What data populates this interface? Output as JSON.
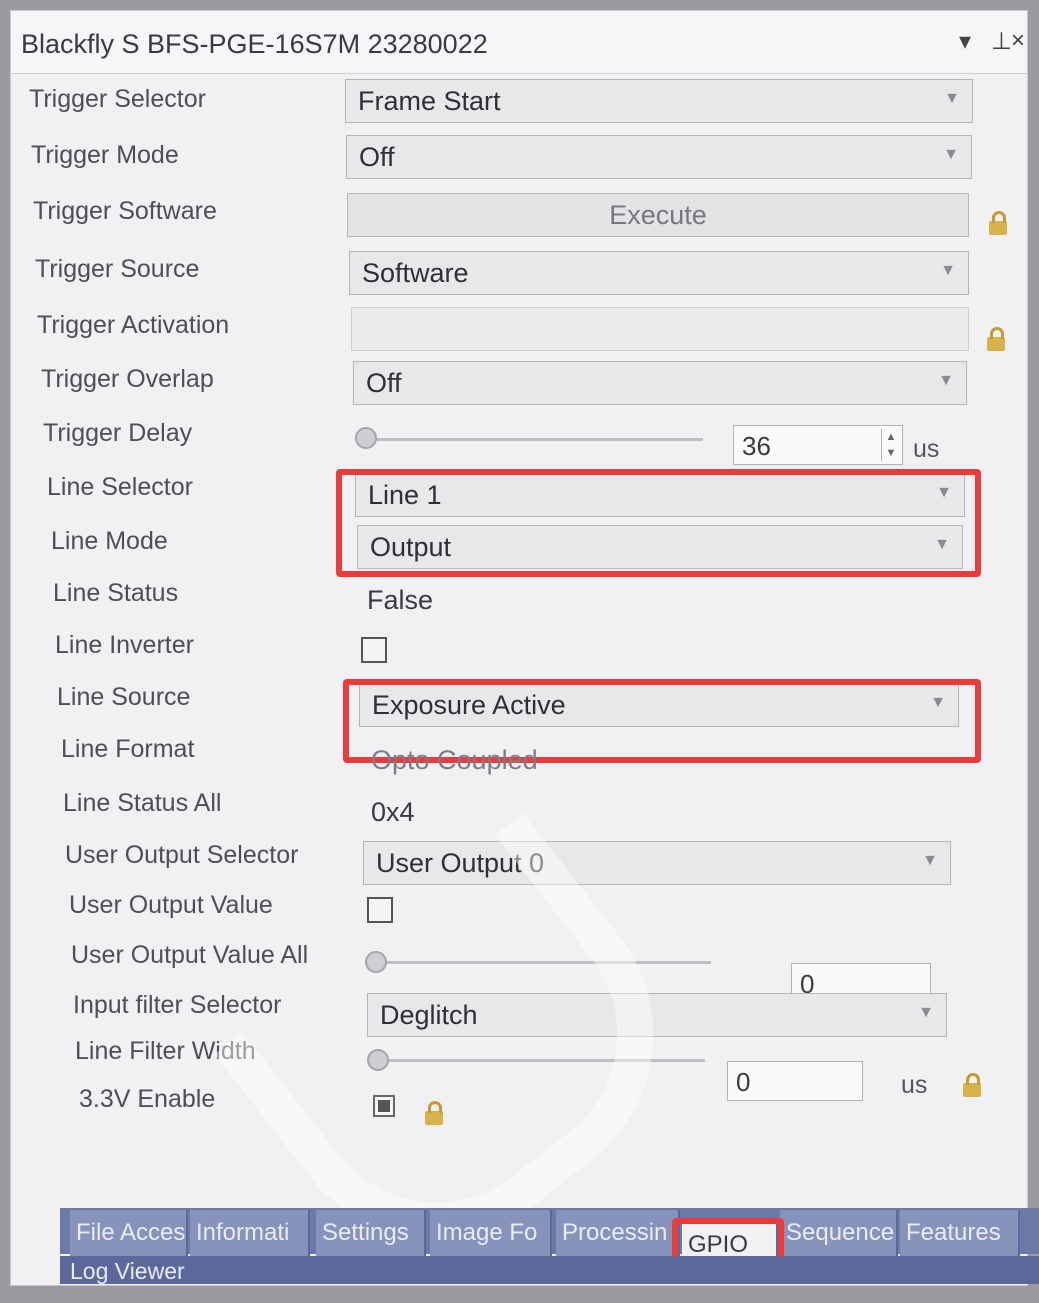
{
  "window": {
    "title": "Blackfly S BFS-PGE-16S7M 23280022",
    "controls": [
      "▾",
      "⊥",
      "×"
    ]
  },
  "properties": {
    "trigger_selector": {
      "label": "Trigger Selector",
      "value": "Frame Start"
    },
    "trigger_mode": {
      "label": "Trigger Mode",
      "value": "Off"
    },
    "trigger_software": {
      "label": "Trigger Software",
      "button": "Execute"
    },
    "trigger_source": {
      "label": "Trigger Source",
      "value": "Software"
    },
    "trigger_activation": {
      "label": "Trigger Activation",
      "value": ""
    },
    "trigger_overlap": {
      "label": "Trigger Overlap",
      "value": "Off"
    },
    "trigger_delay": {
      "label": "Trigger Delay",
      "value": "36",
      "unit": "us",
      "slider_fraction": 0.0
    },
    "line_selector": {
      "label": "Line Selector",
      "value": "Line 1"
    },
    "line_mode": {
      "label": "Line Mode",
      "value": "Output"
    },
    "line_status": {
      "label": "Line Status",
      "value": "False"
    },
    "line_inverter": {
      "label": "Line Inverter",
      "checked": false
    },
    "line_source": {
      "label": "Line Source",
      "value": "Exposure Active"
    },
    "line_format": {
      "label": "Line Format",
      "value": "Opto Coupled"
    },
    "line_status_all": {
      "label": "Line Status All",
      "value": "0x4"
    },
    "user_output_selector": {
      "label": "User Output Selector",
      "value": "User Output 0"
    },
    "user_output_value": {
      "label": "User Output Value",
      "checked": false
    },
    "user_output_value_all": {
      "label": "User Output Value All",
      "value": "0",
      "slider_fraction": 0.0
    },
    "input_filter_selector": {
      "label": "Input filter Selector",
      "value": "Deglitch"
    },
    "line_filter_width": {
      "label": "Line Filter Width",
      "value": "0",
      "unit": "us",
      "slider_fraction": 0.0
    },
    "enable_3v3": {
      "label": "3.3V Enable",
      "checked": true
    }
  },
  "tabs": [
    "File Acces",
    "Informati",
    "Settings",
    "Image Fo",
    "Processin",
    "GPIO",
    "Sequence",
    "Features"
  ],
  "active_tab": "GPIO",
  "bottom_tab": "Log Viewer",
  "colors": {
    "highlight": "#ec3b3b",
    "tab_bg": "#6d7aa8"
  }
}
